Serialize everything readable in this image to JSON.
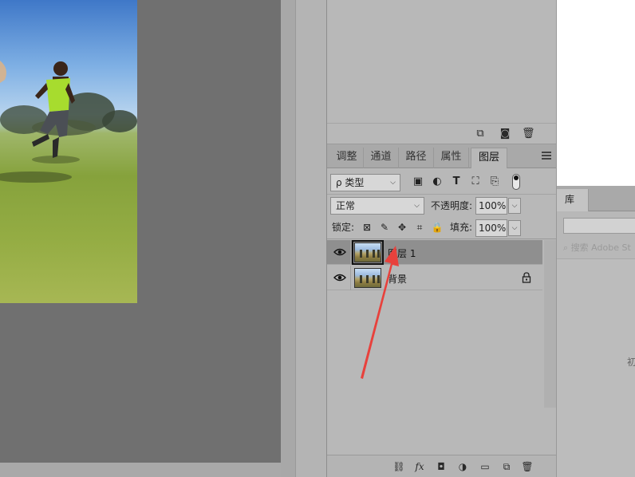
{
  "canvas": {
    "image": "photo-of-boy-running-on-grass"
  },
  "upper_panel": {
    "icons": [
      "new-group-icon",
      "camera-icon",
      "trash-icon"
    ]
  },
  "tabs": [
    {
      "label": "调整"
    },
    {
      "label": "通道"
    },
    {
      "label": "路径"
    },
    {
      "label": "属性"
    },
    {
      "label": "图层",
      "active": true
    }
  ],
  "filter": {
    "kind_label": "ρ 类型",
    "icons": [
      "image-filter-icon",
      "adjustment-filter-icon",
      "type-filter-icon",
      "shape-filter-icon",
      "smart-object-filter-icon",
      "filter-toggle"
    ]
  },
  "blend": {
    "mode": "正常",
    "opacity_label": "不透明度:",
    "opacity_value": "100%"
  },
  "lock": {
    "label": "锁定:",
    "fill_label": "填充:",
    "fill_value": "100%"
  },
  "layers": [
    {
      "name": "图层 1",
      "selected": true,
      "locked": false
    },
    {
      "name": "背景",
      "selected": false,
      "locked": true
    }
  ],
  "bottom_toolbar": {
    "icons": [
      "link-icon",
      "fx-icon",
      "mask-icon",
      "adjustment-icon",
      "folder-icon",
      "new-layer-icon",
      "trash-icon"
    ],
    "fx_label": "fx"
  },
  "library": {
    "tab_label": "库",
    "search_placeholder": "搜索 Adobe St",
    "hint_char": "初"
  },
  "colors": {
    "panel_bg": "#b8b8b8",
    "selected_layer": "#8f8f8f",
    "annotation_arrow": "#e8413c"
  }
}
